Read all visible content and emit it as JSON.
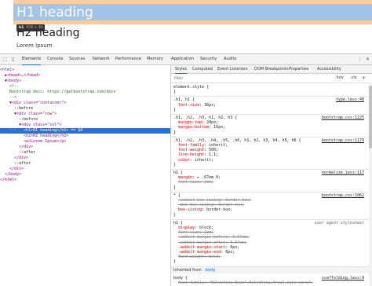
{
  "preview": {
    "h1": "H1 heading",
    "h2": "H2 heading",
    "p": "Lorem Ipsum",
    "tooltip_tag": "h1",
    "tooltip_dims": "978 × 39"
  },
  "devtools": {
    "tabs": [
      "Elements",
      "Console",
      "Sources",
      "Network",
      "Performance",
      "Memory",
      "Application",
      "Security",
      "Audits"
    ],
    "active_tab": "Elements",
    "elements": [
      {
        "t": "<html>",
        "cls": ""
      },
      {
        "t": "  ▶<head>…</head>",
        "cls": ""
      },
      {
        "t": "  ▼<body>",
        "cls": ""
      },
      {
        "t": "    <!--",
        "cls": "cmt"
      },
      {
        "t": "    Bootstrap docs: https://getbootstrap.com/docs",
        "cls": "cmt"
      },
      {
        "t": "    -->",
        "cls": "cmt"
      },
      {
        "t": "    ▼<div class=\"container\">",
        "cls": ""
      },
      {
        "t": "      ::before",
        "cls": "txt"
      },
      {
        "t": "      ▼<div class=\"row\">",
        "cls": ""
      },
      {
        "t": "        ::before",
        "cls": "txt"
      },
      {
        "t": "        ▼<div class=\"col\">",
        "cls": ""
      },
      {
        "t": "    ···   <h1>H1 heading</h1> == $0",
        "cls": "sel"
      },
      {
        "t": "          <h2>H2 heading</h2>",
        "cls": ""
      },
      {
        "t": "          <p>Lorem Ipsum</p>",
        "cls": ""
      },
      {
        "t": "        </div>",
        "cls": ""
      },
      {
        "t": "        ::after",
        "cls": "txt"
      },
      {
        "t": "      </div>",
        "cls": ""
      },
      {
        "t": "      ::after",
        "cls": "txt"
      },
      {
        "t": "    </div>",
        "cls": ""
      },
      {
        "t": "  </body>",
        "cls": ""
      },
      {
        "t": "</html>",
        "cls": ""
      }
    ],
    "subtabs": [
      "Styles",
      "Computed",
      "Event Listeners",
      "DOM Breakpoints",
      "Properties",
      "Accessibility"
    ],
    "active_subtab": "Styles",
    "filter_placeholder": "Filter",
    "hov": ":hov",
    "cls": ".cls",
    "plus": "+",
    "rules": [
      {
        "lines": [
          {
            "t": "element.style {"
          },
          {
            "t": "}"
          }
        ],
        "src": ""
      },
      {
        "lines": [
          {
            "t": ".h1, h1 {"
          },
          {
            "p": "font-size",
            "v": "36px;"
          },
          {
            "t": "}"
          }
        ],
        "src": "type.less:48"
      },
      {
        "lines": [
          {
            "t": ".h1, .h2, .h3, h1, h2, h3 {"
          },
          {
            "p": "margin-top",
            "v": "20px;"
          },
          {
            "p": "margin-bottom",
            "v": "10px;"
          },
          {
            "t": "}"
          }
        ],
        "src": "bootstrap.css:1225"
      },
      {
        "lines": [
          {
            "t": ".h1, .h2, .h3, .h4, .h5, .h6, h1, h2, h3, h4, h5, h6 {"
          },
          {
            "p": "font-family",
            "v": "inherit;"
          },
          {
            "p": "font-weight",
            "v": "500;"
          },
          {
            "p": "line-height",
            "v": "1.1;"
          },
          {
            "p": "color",
            "v": "inherit;"
          },
          {
            "t": "}"
          }
        ],
        "src": "bootstrap.css:1179"
      },
      {
        "lines": [
          {
            "t": "h1 {"
          },
          {
            "p": "margin",
            "v": "▸ .67em 0;"
          },
          {
            "p": "font-size",
            "v": "2em;",
            "s": true
          },
          {
            "t": "}"
          }
        ],
        "src": "normalize.less:117"
      },
      {
        "lines": [
          {
            "t": "* {"
          },
          {
            "p": "-webkit-box-sizing",
            "v": "border-box;",
            "s": true
          },
          {
            "p": "-moz-box-sizing",
            "v": "border-box;",
            "s": true
          },
          {
            "p": "box-sizing",
            "v": "border-box;"
          },
          {
            "t": "}"
          }
        ],
        "src": "bootstrap.css:1062"
      },
      {
        "lines": [
          {
            "t": "h1 {"
          },
          {
            "p": "display",
            "v": "block;"
          },
          {
            "p": "font-size",
            "v": "2em;",
            "s": true
          },
          {
            "p": "-webkit-margin-before",
            "v": "0.67em;",
            "s": true
          },
          {
            "p": "-webkit-margin-after",
            "v": "0.67em;",
            "s": true
          },
          {
            "p": "-webkit-margin-start",
            "v": "0px;"
          },
          {
            "p": "-webkit-margin-end",
            "v": "0px;"
          },
          {
            "p": "font-weight",
            "v": "bold;",
            "s": true
          },
          {
            "t": "}"
          }
        ],
        "src": "user agent stylesheet",
        "plain": true
      }
    ],
    "inherited_label": "Inherited from",
    "inherited_tag": "body",
    "body_rule": {
      "lines": [
        {
          "t": "body {"
        },
        {
          "p": "font-family",
          "v": "\"Helvetica Neue\",Helvetica,Arial,sans-serif;",
          "s": true
        }
      ],
      "src": "scaffolding.less:9"
    }
  },
  "colors": {
    "accent": "#1a73e8",
    "margin_overlay": "#f9cc9d",
    "content_overlay": "#a0c5e8"
  }
}
